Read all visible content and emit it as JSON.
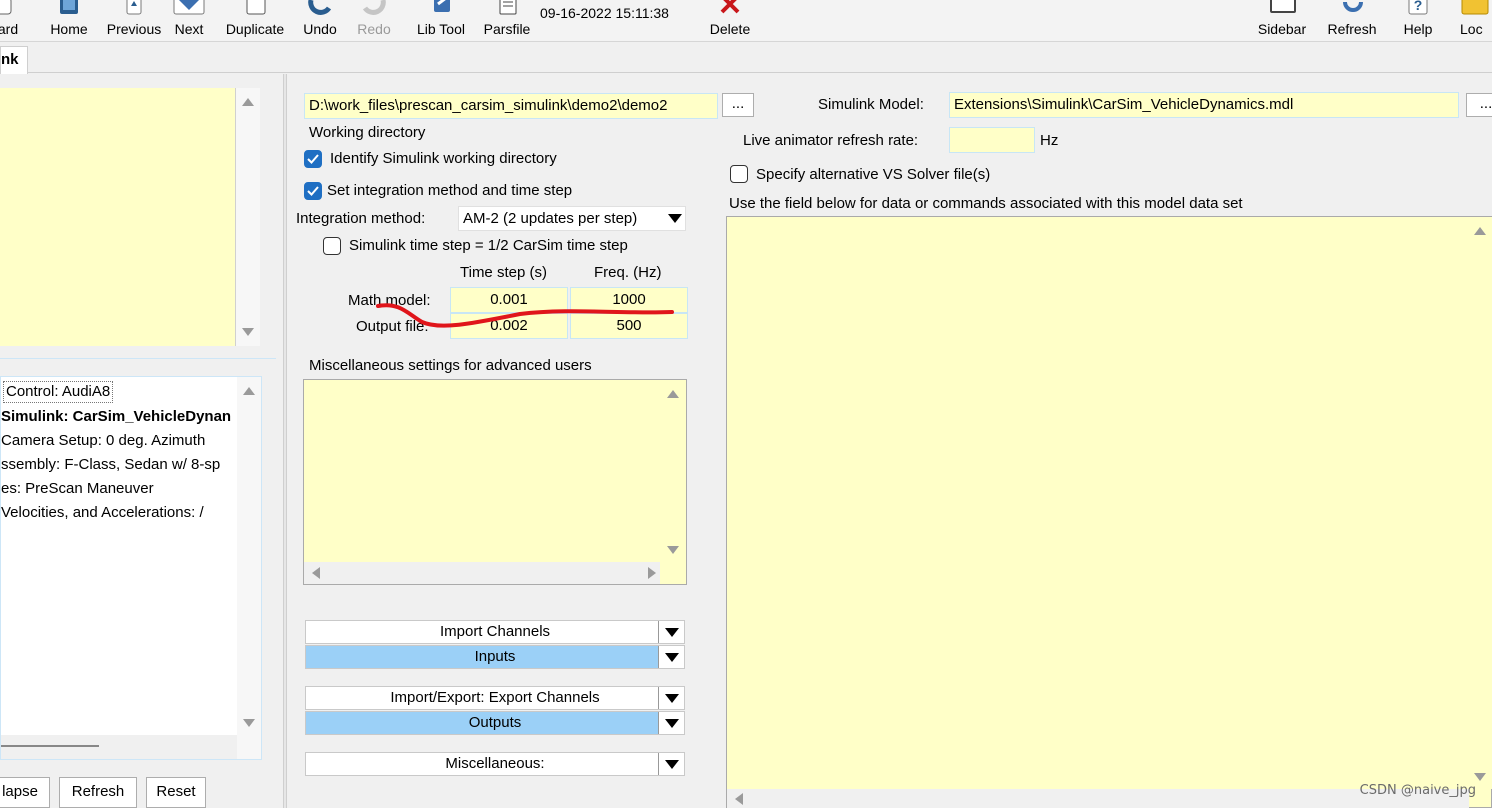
{
  "toolbar": {
    "items": [
      {
        "label": "ard",
        "disabled": false
      },
      {
        "label": "Home",
        "disabled": false
      },
      {
        "label": "Previous",
        "disabled": false
      },
      {
        "label": "Next",
        "disabled": false
      },
      {
        "label": "Duplicate",
        "disabled": false
      },
      {
        "label": "Undo",
        "disabled": false
      },
      {
        "label": "Redo",
        "disabled": true
      },
      {
        "label": "Lib Tool",
        "disabled": false
      },
      {
        "label": "Parsfile",
        "disabled": false
      },
      {
        "label": "Delete",
        "disabled": false
      },
      {
        "label": "Sidebar",
        "disabled": false
      },
      {
        "label": "Refresh",
        "disabled": false
      },
      {
        "label": "Help",
        "disabled": false
      },
      {
        "label": "Loc",
        "disabled": false
      }
    ],
    "timestamp": "09-16-2022 15:11:38"
  },
  "tab": {
    "label": "nk"
  },
  "left_panel": {
    "tree_items": [
      "Control: AudiA8",
      "Simulink: CarSim_VehicleDynan",
      " Camera Setup: 0 deg. Azimuth",
      "ssembly: F-Class, Sedan w/ 8-sp",
      "es: PreScan Maneuver",
      " Velocities, and Accelerations: /"
    ],
    "buttons": {
      "collapse": "lapse",
      "refresh": "Refresh",
      "reset": "Reset"
    }
  },
  "middle": {
    "working_dir_path": "D:\\work_files\\prescan_carsim_simulink\\demo2\\demo2",
    "browse_label": "...",
    "working_dir_label": "Working directory",
    "identify_label": "Identify Simulink working directory",
    "identify_checked": true,
    "set_integration_label": "Set integration method and time step",
    "set_integration_checked": true,
    "integration_method_label": "Integration method:",
    "integration_method_value": "AM-2 (2 updates per step)",
    "simulink_step_label": "Simulink time step = 1/2 CarSim time step",
    "simulink_step_checked": false,
    "col_time_step": "Time step (s)",
    "col_freq": "Freq. (Hz)",
    "math_model_label": "Math model:",
    "math_model_step": "0.001",
    "math_model_freq": "1000",
    "output_file_label": "Output file:",
    "output_file_step": "0.002",
    "output_file_freq": "500",
    "misc_label": "Miscellaneous settings for advanced users",
    "dropdowns": [
      {
        "label": "Import Channels",
        "selected": false
      },
      {
        "label": "Inputs",
        "selected": true
      },
      {
        "label": "Import/Export: Export Channels",
        "selected": false
      },
      {
        "label": "Outputs",
        "selected": true
      },
      {
        "label": "Miscellaneous:",
        "selected": false
      }
    ]
  },
  "right": {
    "simulink_model_label": "Simulink Model:",
    "simulink_model_value": "Extensions\\Simulink\\CarSim_VehicleDynamics.mdl",
    "browse_label": "...",
    "refresh_rate_label": "Live animator refresh rate:",
    "refresh_rate_value": "",
    "hz_label": "Hz",
    "alt_solver_label": "Specify alternative VS Solver file(s)",
    "alt_solver_checked": false,
    "field_below_label": "Use the field below  for data or commands associated with this model data set"
  },
  "watermark": "CSDN @naive_jpg",
  "annotation_color": "#e0151b"
}
